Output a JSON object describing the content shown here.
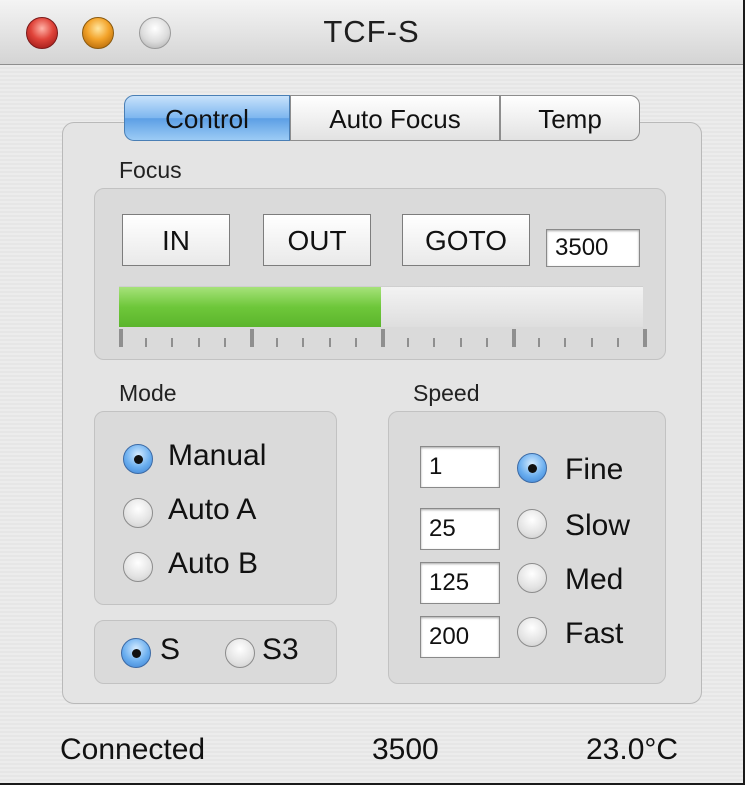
{
  "window": {
    "title": "TCF-S"
  },
  "tabs": [
    {
      "label": "Control",
      "active": true
    },
    {
      "label": "Auto Focus",
      "active": false
    },
    {
      "label": "Temp",
      "active": false
    }
  ],
  "focus": {
    "label": "Focus",
    "in_label": "IN",
    "out_label": "OUT",
    "goto_label": "GOTO",
    "goto_value": "3500",
    "position_fraction": 0.5
  },
  "mode": {
    "label": "Mode",
    "options": [
      {
        "label": "Manual",
        "selected": true
      },
      {
        "label": "Auto A",
        "selected": false
      },
      {
        "label": "Auto B",
        "selected": false
      }
    ],
    "model_options": [
      {
        "label": "S",
        "selected": true
      },
      {
        "label": "S3",
        "selected": false
      }
    ]
  },
  "speed": {
    "label": "Speed",
    "rows": [
      {
        "value": "1",
        "label": "Fine",
        "selected": true
      },
      {
        "value": "25",
        "label": "Slow",
        "selected": false
      },
      {
        "value": "125",
        "label": "Med",
        "selected": false
      },
      {
        "value": "200",
        "label": "Fast",
        "selected": false
      }
    ]
  },
  "status": {
    "connection": "Connected",
    "position": "3500",
    "temperature": "23.0°C"
  },
  "colors": {
    "progress_fill": "#6ec73a",
    "tab_active": "#7db6ef",
    "radio_selected": "#3a7fd0"
  }
}
